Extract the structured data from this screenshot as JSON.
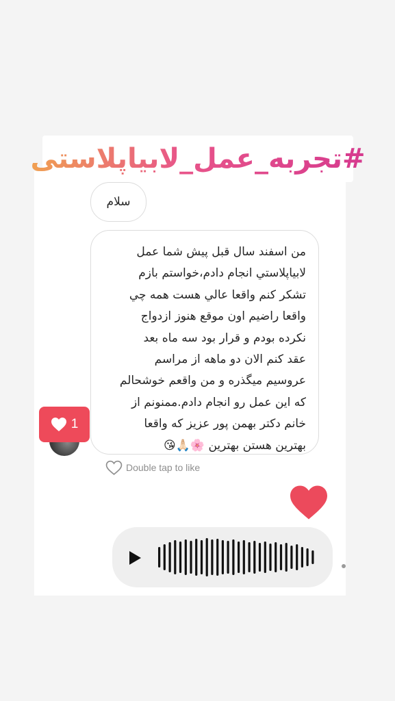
{
  "hashtag": "#تجربه_عمل_لابیاپلاستی",
  "messages": {
    "greeting": "سلام",
    "body_lines": [
      "من اسفند سال قبل پيش شما عمل",
      "لابياپلاستي انجام دادم،خواستم بازم",
      "تشكر كنم واقعا عالي هست همه چي",
      "واقعا راضيم اون موقع هنوز ازدواج",
      "نكرده بودم و قرار بود سه ماه بعد",
      "عقد كنم الان دو ماهه از مراسم",
      "عروسيم ميگذره و من واقعم خوشحالم",
      "كه اين عمل رو انجام دادم.ممنونم از",
      "خانم دكتر بهمن پور عزيز كه واقعا",
      "بهترين هستن بهترين 🌸🙏🏻😘"
    ]
  },
  "like_badge": {
    "count": "1",
    "icon": "heart-icon"
  },
  "double_tap_label": "Double tap to like",
  "colors": {
    "like_red": "#ee4a5a",
    "heart_red": "#ec4a5c",
    "hashtag_gradient_start": "#f0a050",
    "hashtag_gradient_end": "#d63a8e"
  },
  "voice_message": {
    "play_icon": "play-icon",
    "waveform_icon": "waveform-icon"
  }
}
